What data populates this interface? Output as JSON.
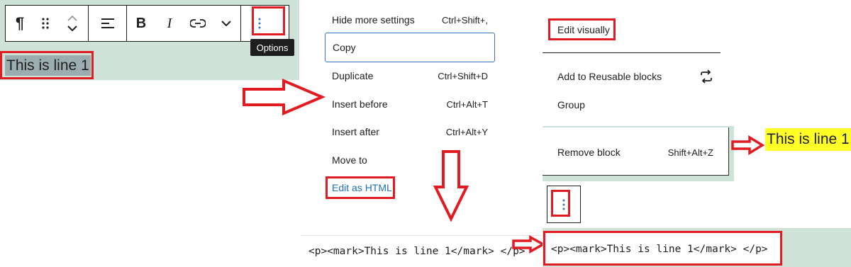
{
  "toolbar": {
    "buttons": [
      {
        "name": "paragraph",
        "glyph": "¶"
      },
      {
        "name": "drag-handle"
      },
      {
        "name": "move-up-down"
      },
      {
        "name": "align"
      },
      {
        "name": "bold",
        "glyph": "B"
      },
      {
        "name": "italic",
        "glyph": "I"
      },
      {
        "name": "link"
      },
      {
        "name": "more-rich-text"
      },
      {
        "name": "options"
      }
    ],
    "tooltip": "Options"
  },
  "block_text": "This is line 1",
  "options_menu": {
    "items": [
      {
        "label": "Hide more settings",
        "shortcut": "Ctrl+Shift+,"
      },
      {
        "label": "Copy",
        "shortcut": ""
      },
      {
        "label": "Duplicate",
        "shortcut": "Ctrl+Shift+D"
      },
      {
        "label": "Insert before",
        "shortcut": "Ctrl+Alt+T"
      },
      {
        "label": "Insert after",
        "shortcut": "Ctrl+Alt+Y"
      },
      {
        "label": "Move to",
        "shortcut": ""
      },
      {
        "label": "Edit as HTML",
        "shortcut": ""
      }
    ]
  },
  "extended_menu": {
    "edit_visually": "Edit visually",
    "add_reusable": "Add to Reusable blocks",
    "group": "Group",
    "remove_block": "Remove block",
    "remove_shortcut": "Shift+Alt+Z"
  },
  "html_code": "<p><mark>This is line 1</mark> </p>",
  "colors": {
    "annotation_red": "#e21b23",
    "block_bg": "#cfe2d8",
    "highlight_yellow": "#ffff26",
    "link_blue": "#2271b1",
    "focus_blue": "#3871c7"
  }
}
